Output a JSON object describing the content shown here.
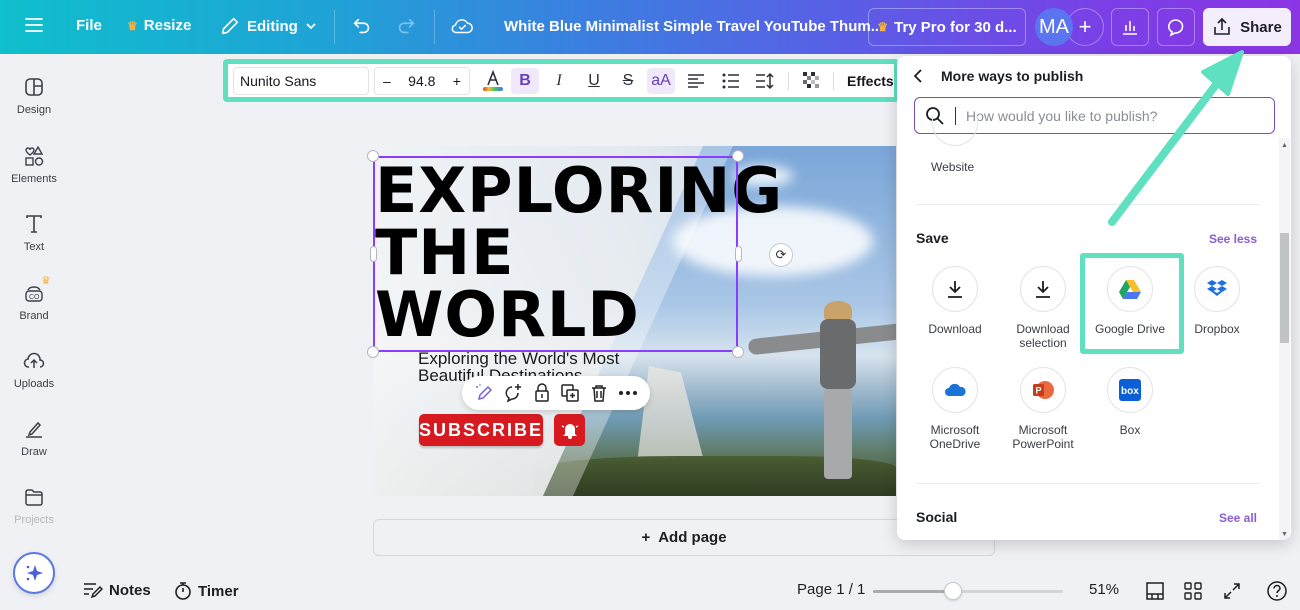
{
  "topbar": {
    "menu_icon": "hamburger-menu-icon",
    "file_label": "File",
    "resize_label": "Resize",
    "editing_label": "Editing",
    "document_title": "White Blue Minimalist Simple Travel YouTube Thum...",
    "try_pro_label": "Try Pro for 30 d...",
    "avatar_initials": "MA",
    "share_label": "Share"
  },
  "sidebar": {
    "items": [
      {
        "label": "Design",
        "icon": "design-icon"
      },
      {
        "label": "Elements",
        "icon": "elements-icon"
      },
      {
        "label": "Text",
        "icon": "text-icon"
      },
      {
        "label": "Brand",
        "icon": "brand-icon"
      },
      {
        "label": "Uploads",
        "icon": "uploads-icon"
      },
      {
        "label": "Draw",
        "icon": "draw-icon"
      },
      {
        "label": "Projects",
        "icon": "projects-icon"
      }
    ]
  },
  "text_toolbar": {
    "font_name": "Nunito Sans",
    "font_size": "94.8",
    "decrease": "–",
    "increase": "+",
    "bold": "B",
    "italic": "I",
    "underline": "U",
    "strike": "S",
    "case": "aA",
    "effects_label": "Effects"
  },
  "canvas": {
    "headline_lines": [
      "EXPLORING",
      "THE",
      "WORLD"
    ],
    "subhead_line1": "Exploring the World's Most",
    "subhead_line2": "Beautiful Destinations",
    "subscribe_label": "SUBSCRIBE"
  },
  "add_page_label": "Add page",
  "bottom_bar": {
    "notes_label": "Notes",
    "timer_label": "Timer",
    "page_indicator": "Page 1 / 1",
    "zoom_percent": "51%",
    "zoom_value": 0.42
  },
  "publish_panel": {
    "title": "More ways to publish",
    "search_placeholder": "How would you like to publish?",
    "website_label": "Website",
    "save_section": {
      "title": "Save",
      "link": "See less",
      "options": [
        {
          "label": "Download",
          "icon": "download-icon"
        },
        {
          "label": "Download selection",
          "icon": "download-selection-icon"
        },
        {
          "label": "Google Drive",
          "icon": "google-drive-icon"
        },
        {
          "label": "Dropbox",
          "icon": "dropbox-icon"
        },
        {
          "label": "Microsoft OneDrive",
          "icon": "onedrive-icon"
        },
        {
          "label": "Microsoft PowerPoint",
          "icon": "powerpoint-icon"
        },
        {
          "label": "Box",
          "icon": "box-icon"
        }
      ]
    },
    "social_section": {
      "title": "Social",
      "link": "See all"
    }
  },
  "colors": {
    "accent_purple": "#8b3dff",
    "highlight_teal": "#5ee0c1",
    "link_purple": "#8b5cd6",
    "youtube_red": "#d71920"
  }
}
